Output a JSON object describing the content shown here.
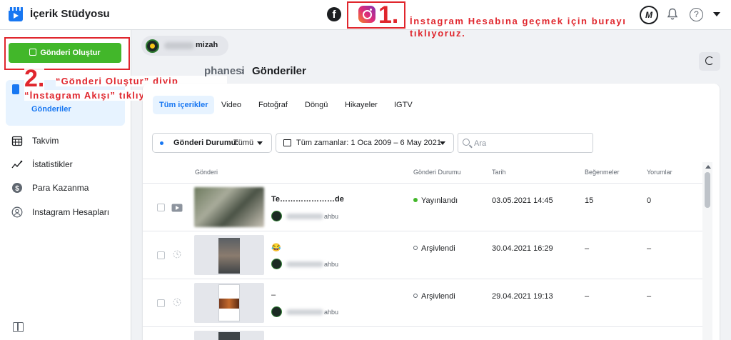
{
  "app": {
    "title": "İçerik Stüdyosu"
  },
  "header": {
    "facebook_icon": "facebook-icon",
    "instagram_icon": "instagram-icon",
    "profile_initial": "M",
    "help_glyph": "?"
  },
  "annotations": {
    "step1_number": "1.",
    "step1_text": "İnstagram  Hesabına geçmek için burayı tıklıyoruz.",
    "step2_number": "2.",
    "step2_text_line1": "“Gönderi Oluştur” diyip",
    "step2_text_line2": "“İnstagram Akışı” tıklıyoruz.",
    "highlight_color": "#e0262d"
  },
  "sidebar": {
    "create_button": "Gönderi Oluştur",
    "active_item": "Gönderiler",
    "items": [
      {
        "label": "Takvim",
        "icon": "calendar-icon"
      },
      {
        "label": "İstatistikler",
        "icon": "chart-icon"
      },
      {
        "label": "Para Kazanma",
        "icon": "dollar-icon"
      },
      {
        "label": "Instagram Hesapları",
        "icon": "accounts-icon"
      }
    ]
  },
  "page": {
    "name_suffix": "mizah"
  },
  "breadcrumb": {
    "library": "phanesi",
    "separator": "›",
    "current": "Gönderiler"
  },
  "tabs": [
    "Tüm içerikler",
    "Video",
    "Fotoğraf",
    "Döngü",
    "Hikayeler",
    "IGTV"
  ],
  "filters": {
    "status_label": "Gönderi Durumu:",
    "status_value": "Tümü",
    "date_range": "Tüm zamanlar: 1 Oca 2009 – 6 May 2021",
    "search_placeholder": "Ara"
  },
  "table": {
    "columns": {
      "post": "Gönderi",
      "status": "Gönderi Durumu",
      "date": "Tarih",
      "likes": "Beğenmeler",
      "comments": "Yorumlar"
    },
    "rows": [
      {
        "title": "Te…………………de",
        "account": "ahbu",
        "status": "Yayınlandı",
        "status_color": "#42b72a",
        "date": "03.05.2021 14:45",
        "likes": "15",
        "comments": "0"
      },
      {
        "title": "😂",
        "account": "ahbu",
        "status": "Arşivlendi",
        "status_color": "#606770",
        "date": "30.04.2021 16:29",
        "likes": "–",
        "comments": "–"
      },
      {
        "title": "–",
        "account": "ahbu",
        "status": "Arşivlendi",
        "status_color": "#606770",
        "date": "29.04.2021 19:13",
        "likes": "–",
        "comments": "–"
      }
    ]
  },
  "colors": {
    "primary": "#1877f2",
    "green": "#42b72a",
    "bg": "#f0f2f5"
  }
}
